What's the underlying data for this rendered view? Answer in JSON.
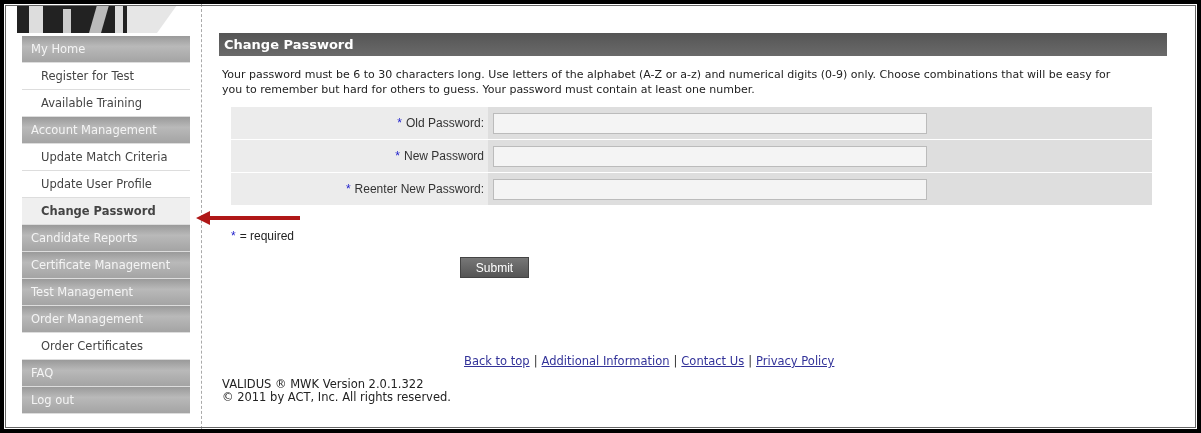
{
  "sidebar": {
    "items": [
      {
        "label": "My Home",
        "kind": "section",
        "selected": false
      },
      {
        "label": "Register for Test",
        "kind": "link",
        "selected": false
      },
      {
        "label": "Available Training",
        "kind": "link",
        "selected": false
      },
      {
        "label": "Account Management",
        "kind": "section",
        "selected": false
      },
      {
        "label": "Update Match Criteria",
        "kind": "link",
        "selected": false
      },
      {
        "label": "Update User Profile",
        "kind": "link",
        "selected": false
      },
      {
        "label": "Change Password",
        "kind": "link",
        "selected": true
      },
      {
        "label": "Candidate Reports",
        "kind": "section",
        "selected": false
      },
      {
        "label": "Certificate Management",
        "kind": "section",
        "selected": false
      },
      {
        "label": "Test Management",
        "kind": "section",
        "selected": false
      },
      {
        "label": "Order Management",
        "kind": "section",
        "selected": false
      },
      {
        "label": "Order Certificates",
        "kind": "link",
        "selected": false
      },
      {
        "label": "FAQ",
        "kind": "section",
        "selected": false
      },
      {
        "label": "Log out",
        "kind": "section",
        "selected": false
      }
    ]
  },
  "page": {
    "title": "Change Password",
    "intro": "Your password must be 6 to 30 characters long. Use letters of the alphabet (A-Z or a-z) and numerical digits (0-9) only. Choose combinations that will be easy for you to remember but hard for others to guess. Your password must contain at least one number.",
    "fields": [
      {
        "asterisk": "*",
        "label": "Old Password:"
      },
      {
        "asterisk": "*",
        "label": "New Password"
      },
      {
        "asterisk": "*",
        "label": "Reenter New Password:"
      }
    ],
    "legend": {
      "asterisk": "*",
      "text": "= required"
    },
    "submit": "Submit"
  },
  "footer": {
    "links": [
      "Back to top",
      "Additional Information",
      "Contact Us",
      "Privacy Policy"
    ],
    "separator": "|",
    "version": "VALIDUS ® MWK Version 2.0.1.322",
    "copyright": "© 2011 by ACT, Inc. All rights reserved."
  }
}
